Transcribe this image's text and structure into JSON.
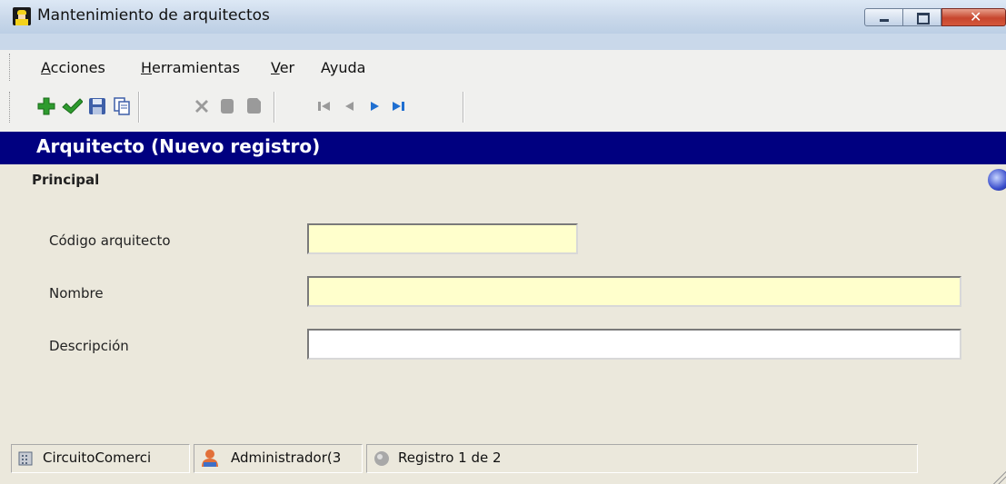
{
  "window": {
    "title": "Mantenimiento de arquitectos"
  },
  "menu": {
    "items": [
      {
        "first": "A",
        "rest": "cciones"
      },
      {
        "first": "H",
        "rest": "erramientas"
      },
      {
        "first": "V",
        "rest": "er"
      },
      {
        "first": "",
        "rest": "Ayuda"
      }
    ]
  },
  "toolbar": {
    "icons": [
      "add-icon",
      "check-icon",
      "save-icon",
      "copy-icon",
      "delete-icon",
      "stop-icon",
      "stop-alt-icon",
      "first-record-icon",
      "previous-record-icon",
      "next-record-icon",
      "last-record-icon"
    ],
    "colors": {
      "add": "#2e9b2e",
      "check": "#2e9b2e",
      "disabled": "#9a9a9a",
      "nav_active": "#1f6fd1"
    }
  },
  "header": {
    "title": "Arquitecto  (Nuevo registro)"
  },
  "form": {
    "section": "Principal",
    "fields": {
      "codigo": {
        "label": "Código arquitecto",
        "value": ""
      },
      "nombre": {
        "label": "Nombre",
        "value": ""
      },
      "descripcion": {
        "label": "Descripción",
        "value": ""
      }
    }
  },
  "status": {
    "database": "CircuitoComerci",
    "user": "Administrador(3",
    "record": "Registro 1 de 2"
  },
  "colors": {
    "header_bg": "#000080",
    "required_field": "#ffffcc",
    "panel": "#ebe8dc"
  }
}
